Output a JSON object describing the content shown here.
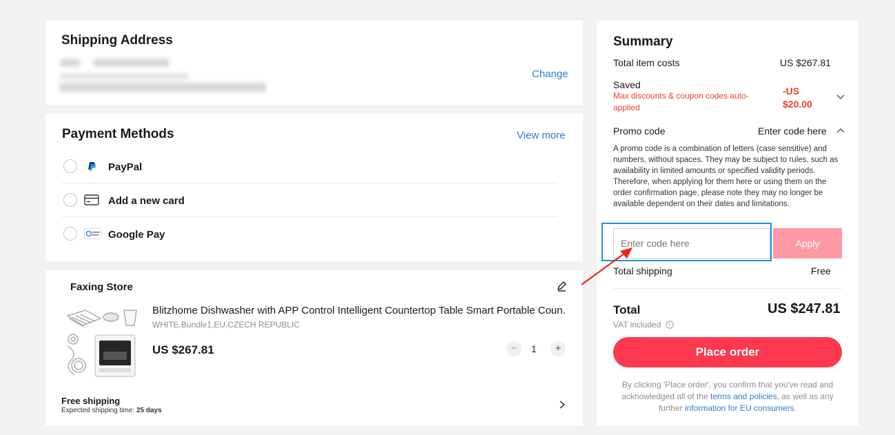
{
  "shipping_address": {
    "title": "Shipping Address",
    "change_label": "Change"
  },
  "payment": {
    "title": "Payment Methods",
    "view_more_label": "View more",
    "methods": [
      {
        "label": "PayPal"
      },
      {
        "label": "Add a new card"
      },
      {
        "label": "Google Pay"
      }
    ]
  },
  "store": {
    "name": "Faxing Store",
    "item": {
      "title": "Blitzhome Dishwasher with APP Control Intelligent Countertop Table Smart Portable Coun...",
      "variant": "WHITE,Bundle1,EU,CZECH REPUBLIC",
      "price": "US $267.81",
      "quantity": "1",
      "minus": "−",
      "plus": "+"
    },
    "shipping": {
      "title": "Free shipping",
      "time_label": "Expected shipping time:",
      "time_value": "25 days"
    }
  },
  "summary": {
    "title": "Summary",
    "total_item_costs_label": "Total item costs",
    "total_item_costs_value": "US $267.81",
    "saved_label": "Saved",
    "saved_note": "Max discounts & coupon codes auto-applied",
    "saved_value": "-US $20.00",
    "promo_label": "Promo code",
    "promo_toggle": "Enter code here",
    "promo_description": "A promo code is a combination of letters (case sensitive) and numbers, without spaces. They may be subject to rules, such as availability in limited amounts or specified validity periods. Therefore, when applying for them here or using them on the order confirmation page, please note they may no longer be available dependent on their dates and limitations.",
    "promo_input_placeholder": "Enter code here",
    "apply_label": "Apply",
    "total_shipping_label": "Total shipping",
    "total_shipping_value": "Free",
    "total_label": "Total",
    "total_value": "US $247.81",
    "vat_label": "VAT included",
    "place_order_label": "Place order",
    "terms_prefix": "By clicking 'Place order', you confirm that you've read and acknowledged all of the",
    "terms_link": "terms and policies",
    "terms_middle": ", as well as any further",
    "eu_link": "information for EU consumers",
    "terms_suffix": "."
  },
  "colors": {
    "accent_red": "#fd384f",
    "apply_disabled": "#ff99a6",
    "link_blue": "#2e7bd6",
    "highlight_box": "#1a8fe3",
    "annotation_arrow": "#e8261d"
  }
}
